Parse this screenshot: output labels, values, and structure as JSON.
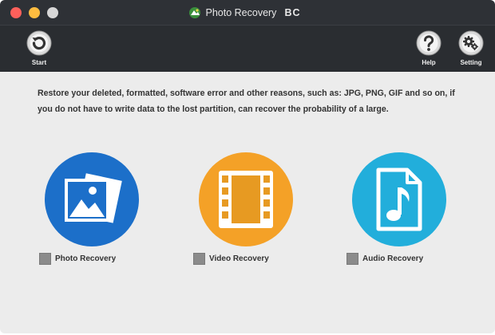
{
  "window": {
    "title": "Photo Recovery",
    "title_suffix": "BC"
  },
  "toolbar": {
    "start_label": "Start",
    "help_label": "Help",
    "setting_label": "Setting"
  },
  "main": {
    "description": "Restore your deleted, formatted, software error and other reasons, such as: JPG, PNG, GIF and so on, if you do not have to write data to the lost partition, can recover the probability of a large.",
    "options": [
      {
        "label": "Photo Recovery",
        "icon": "photo-icon",
        "color": "#1c6fc9",
        "checked": false
      },
      {
        "label": "Video Recovery",
        "icon": "film-icon",
        "color": "#f4a127",
        "checked": false
      },
      {
        "label": "Audio Recovery",
        "icon": "music-file-icon",
        "color": "#22aedb",
        "checked": false
      }
    ]
  },
  "colors": {
    "titlebar": "#2e3136",
    "toolbar": "#2a2d31",
    "background": "#ececec"
  }
}
